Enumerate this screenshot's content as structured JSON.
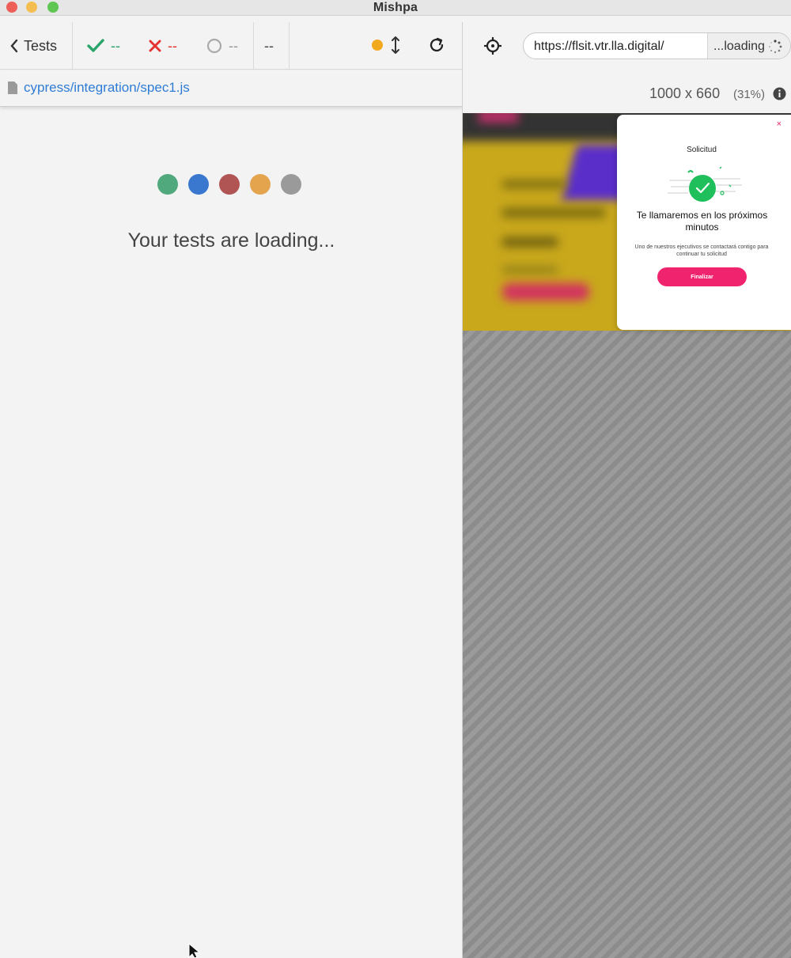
{
  "window": {
    "title": "Mishpa"
  },
  "reporter": {
    "back_label": "Tests",
    "stats": {
      "passed": "--",
      "failed": "--",
      "pending": "--",
      "duration": "--"
    },
    "spec_path": "cypress/integration/spec1.js",
    "loading_message": "Your tests are loading...",
    "loading_dots": [
      "#4fa97c",
      "#3a78cf",
      "#b05454",
      "#e4a44d",
      "#9a9a9a"
    ]
  },
  "aut": {
    "url": "https://flsit.vtr.lla.digital/",
    "url_status": "...loading",
    "viewport_size": "1000 x 660",
    "viewport_scale": "(31%)"
  },
  "modal": {
    "close": "×",
    "heading": "Solicitud",
    "title": "Te llamaremos en los próximos minutos",
    "body": "Uno de nuestros ejecutivos se contactará contigo para continuar tu solicitud",
    "button": "Finalizar"
  },
  "colors": {
    "accent": "#2f7cd6",
    "passed": "#29a46a",
    "failed": "#e5332f",
    "running": "#f3a91d",
    "cta": "#f0246e",
    "success": "#1fbf5b"
  }
}
